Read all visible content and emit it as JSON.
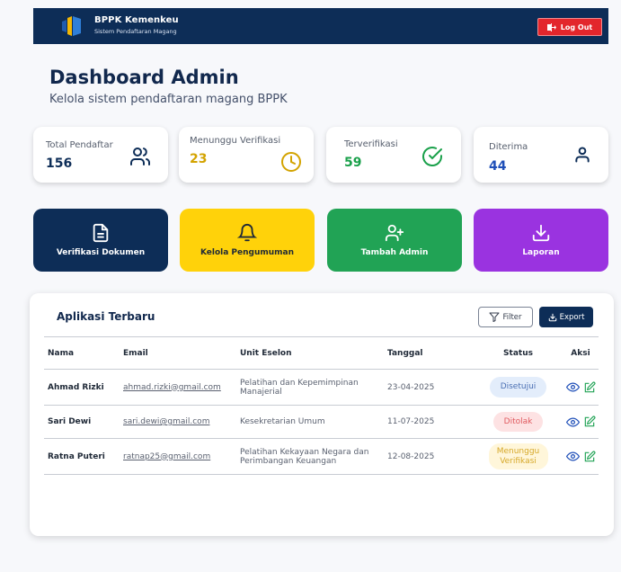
{
  "nav": {
    "brand_title": "BPPK Kemenkeu",
    "brand_subtitle": "Sistem Pendaftaran Magang",
    "logout_label": "Log Out"
  },
  "header": {
    "title": "Dashboard Admin",
    "subtitle": "Kelola sistem pendaftaran magang BPPK"
  },
  "stats": [
    {
      "label": "Total Pendaftar",
      "value": "156",
      "icon": "users-icon",
      "color": "#0d2d57"
    },
    {
      "label": "Menunggu Verifikasi",
      "value": "23",
      "icon": "clock-icon",
      "color": "#d3a300"
    },
    {
      "label": "Terverifikasi",
      "value": "59",
      "icon": "check-circle-icon",
      "color": "#19a04a"
    },
    {
      "label": "Diterima",
      "value": "44",
      "icon": "user-icon",
      "color": "#1f4fb8"
    }
  ],
  "actions": [
    {
      "label": "Verifikasi Dokumen",
      "icon": "document-icon",
      "bg": "#0d2d57",
      "fg": "#ffffff"
    },
    {
      "label": "Kelola Pengumuman",
      "icon": "bell-icon",
      "bg": "#ffd20a",
      "fg": "#1f2937"
    },
    {
      "label": "Tambah Admin",
      "icon": "user-plus-icon",
      "bg": "#21a355",
      "fg": "#ffffff"
    },
    {
      "label": "Laporan",
      "icon": "download-icon",
      "bg": "#9a33e0",
      "fg": "#ffffff"
    }
  ],
  "applications": {
    "title": "Aplikasi Terbaru",
    "filter_label": "Filter",
    "export_label": "Export",
    "columns": [
      "Nama",
      "Email",
      "Unit Eselon",
      "Tanggal",
      "Status",
      "Aksi"
    ],
    "rows": [
      {
        "name": "Ahmad Rizki",
        "email": "ahmad.rizki@gmail.com",
        "unit": "Pelatihan dan Kepemimpinan Manajerial",
        "date": "23-04-2025",
        "status": "Disetujui"
      },
      {
        "name": "Sari Dewi",
        "email": "sari.dewi@gmail.com",
        "unit": "Kesekretarian Umum",
        "date": "11-07-2025",
        "status": "Ditolak"
      },
      {
        "name": "Ratna Puteri",
        "email": "ratnap25@gmail.com",
        "unit": "Pelatihan Kekayaan Negara dan Perimbangan Keuangan",
        "date": "12-08-2025",
        "status": "Menunggu Verifikasi"
      }
    ],
    "status_colors": {
      "Disetujui": {
        "bg": "#e3edfb",
        "fg": "#4a6fb3"
      },
      "Ditolak": {
        "bg": "#fde2e3",
        "fg": "#e05a5f"
      },
      "Menunggu Verifikasi": {
        "bg": "#fff6da",
        "fg": "#d6a829"
      }
    }
  }
}
